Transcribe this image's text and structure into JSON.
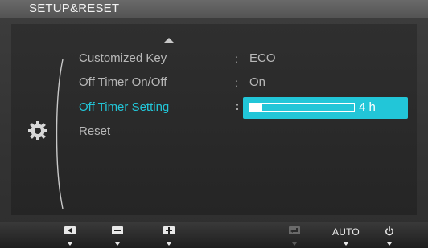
{
  "window": {
    "title": "SETUP&RESET"
  },
  "menu": {
    "items": [
      {
        "label": "Customized Key",
        "value": "ECO",
        "active": false
      },
      {
        "label": "Off Timer On/Off",
        "value": "On",
        "active": false
      },
      {
        "label": "Off Timer Setting",
        "value": "",
        "active": true
      },
      {
        "label": "Reset",
        "value": "",
        "active": false
      }
    ],
    "separator": ":",
    "scroll_up_icon": "triangle-up-icon",
    "category_icon": "gear-icon"
  },
  "selector": {
    "bar_value_text": "4 h",
    "bar_fill_fraction": 0.12
  },
  "bottom_bar": {
    "buttons": [
      {
        "icon": "left-arrow-icon",
        "label": ""
      },
      {
        "icon": "minus-icon",
        "label": ""
      },
      {
        "icon": "plus-icon",
        "label": ""
      },
      {
        "icon": "enter-icon",
        "label": ""
      },
      {
        "icon": "",
        "label": "AUTO"
      },
      {
        "icon": "power-icon",
        "label": ""
      }
    ]
  },
  "colors": {
    "accent": "#22c6d8",
    "text": "#b8b8b8",
    "background": "#2f2f2f"
  }
}
